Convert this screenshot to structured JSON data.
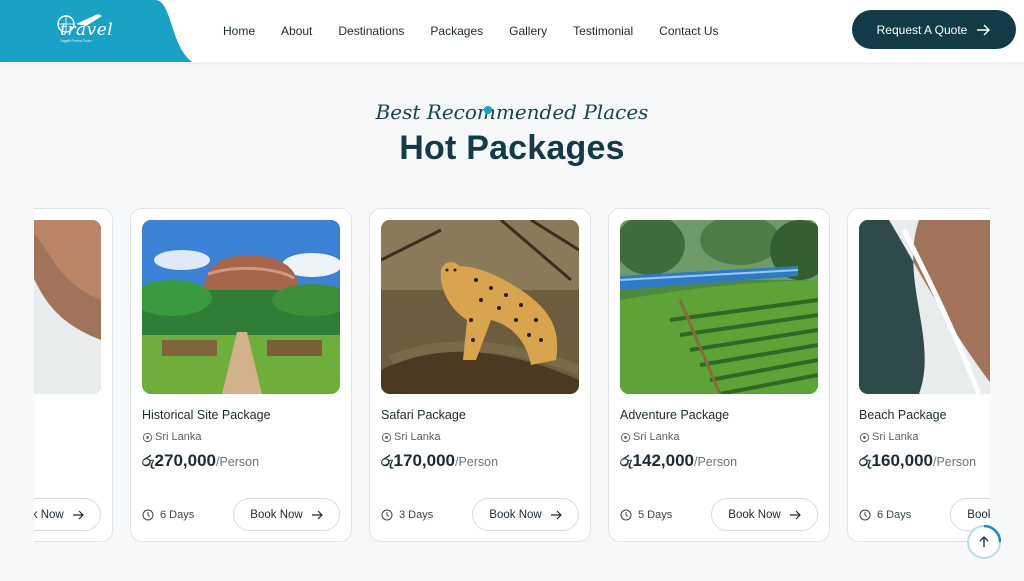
{
  "header": {
    "logo_text": "travel",
    "logo_tagline": "Jagath Perera Tours",
    "nav": [
      "Home",
      "About",
      "Destinations",
      "Packages",
      "Gallery",
      "Testimonial",
      "Contact Us"
    ],
    "cta_label": "Request A Quote"
  },
  "section": {
    "eyebrow": "Best Recommended Places",
    "title": "Hot Packages"
  },
  "currency_symbol": "රු",
  "cards": [
    {
      "title": "",
      "location": "",
      "price": "",
      "unit": "",
      "days": "",
      "book_label": "Book Now",
      "image": "beach-aerial"
    },
    {
      "title": "Historical Site Package",
      "location": "Sri Lanka",
      "price": "270,000",
      "unit": "/Person",
      "days": "6 Days",
      "book_label": "Book Now",
      "image": "sigiriya-rock"
    },
    {
      "title": "Safari Package",
      "location": "Sri Lanka",
      "price": "170,000",
      "unit": "/Person",
      "days": "3 Days",
      "book_label": "Book Now",
      "image": "leopard"
    },
    {
      "title": "Adventure Package",
      "location": "Sri Lanka",
      "price": "142,000",
      "unit": "/Person",
      "days": "5 Days",
      "book_label": "Book Now",
      "image": "blue-train-tea-estate"
    },
    {
      "title": "Beach Package",
      "location": "Sri Lanka",
      "price": "160,000",
      "unit": "/Person",
      "days": "6 Days",
      "book_label": "Book Now",
      "image": "beach-aerial"
    }
  ],
  "colors": {
    "brand_dark": "#123a47",
    "brand_cyan": "#1aa1c6"
  }
}
